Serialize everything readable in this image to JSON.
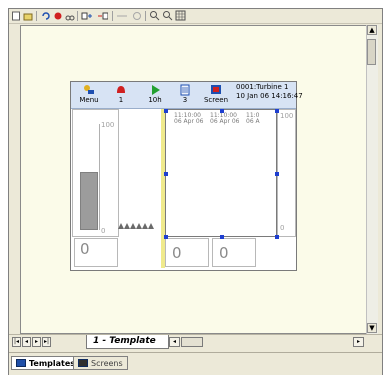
{
  "toolbar": {
    "icons": [
      "new-icon",
      "open-icon",
      "undo-icon",
      "redo-icon",
      "cut-icon",
      "copy-icon",
      "paste-icon",
      "delete-icon",
      "zoom-in-icon",
      "zoom-out-icon",
      "grid-icon"
    ]
  },
  "screen": {
    "header_buttons": [
      {
        "icon": "menu-icon",
        "label": "Menu"
      },
      {
        "icon": "alarm-bell-icon",
        "label": "1"
      },
      {
        "icon": "play-icon",
        "label": "10h"
      },
      {
        "icon": "log-icon",
        "label": "3"
      },
      {
        "icon": "screen-icon",
        "label": "Screen"
      }
    ],
    "status": {
      "unit": "0001:Turbine 1",
      "datetime": "10 Jan 06  14:16:47"
    },
    "left_panel": {
      "scale_top": "100",
      "scale_bottom": "0",
      "digital_value": "0",
      "bar_fraction": 0.55
    },
    "trend": {
      "timestamps": [
        "11:10:00\n06 Apr 06",
        "11:10:00\n06 Apr 06",
        "11:0\n06 A"
      ],
      "scale_top": "100",
      "scale_bottom": "0"
    },
    "digital_values": [
      "0",
      "0"
    ]
  },
  "sheet_tab": {
    "label": "1 - Template"
  },
  "bottom_tabs": [
    {
      "label": "Templates",
      "active": true
    },
    {
      "label": "Screens",
      "active": false
    }
  ],
  "colors": {
    "accent": "#1e3fd0",
    "header_bg": "#d7e3f4",
    "canvas_bg": "#fbfbe9"
  }
}
